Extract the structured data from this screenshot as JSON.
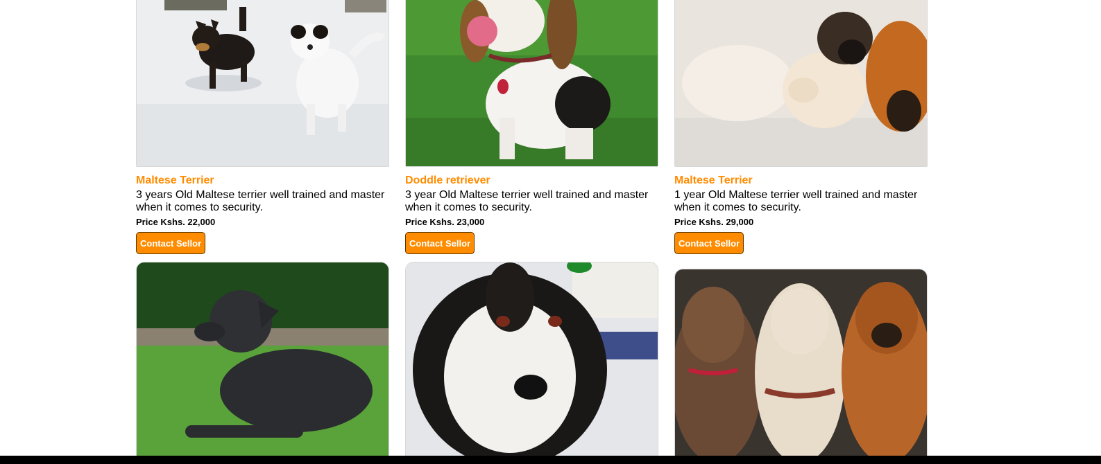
{
  "listings": [
    {
      "title": "Maltese Terrier",
      "description": "3 years Old Maltese terrier well trained and master when it comes to security.",
      "price": "Price Kshs. 22,000",
      "button": "Contact Sellor",
      "image": "two-dogs-running-in-snow"
    },
    {
      "title": "Doddle retriever",
      "description": "3 year Old Maltese terrier well trained and master when it comes to security.",
      "price": "Price Kshs. 23,000",
      "button": "Contact Sellor",
      "image": "beagle-sitting-on-grass"
    },
    {
      "title": "Maltese Terrier",
      "description": "1 year Old Maltese terrier well trained and master when it comes to security.",
      "price": "Price Kshs. 29,000",
      "button": "Contact Sellor",
      "image": "puppies-cuddling"
    }
  ],
  "next_row_images": [
    "black-dog-lying-on-lawn",
    "husky-in-snow",
    "three-dogs-portrait"
  ],
  "colors": {
    "accent": "#ff8c00",
    "text": "#000000",
    "background": "#ffffff"
  }
}
